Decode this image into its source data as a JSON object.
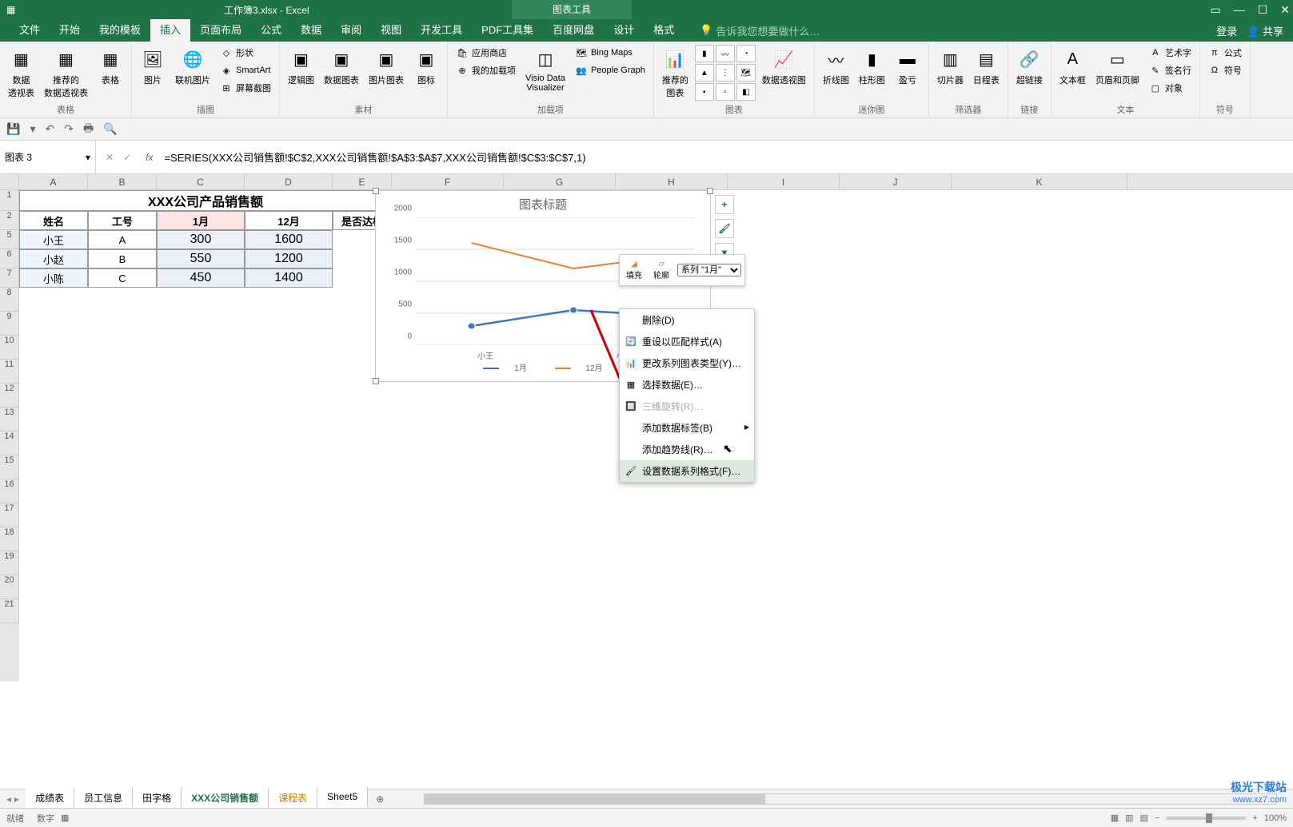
{
  "window": {
    "filename": "工作簿3.xlsx - Excel",
    "tool_tab": "图表工具"
  },
  "tabs": {
    "file": "文件",
    "home": "开始",
    "mytpl": "我的模板",
    "insert": "插入",
    "layout": "页面布局",
    "formula": "公式",
    "data": "数据",
    "review": "审阅",
    "view": "视图",
    "dev": "开发工具",
    "pdf": "PDF工具集",
    "baidu": "百度网盘",
    "design": "设计",
    "format": "格式",
    "tellme": "告诉我您想要做什么…",
    "login": "登录",
    "share": "共享"
  },
  "ribbon": {
    "tables": {
      "pivot": "数据\n透视表",
      "rec_pivot": "推荐的\n数据透视表",
      "table": "表格",
      "group": "表格"
    },
    "illust": {
      "pic": "图片",
      "online": "联机图片",
      "shapes": "形状",
      "smartart": "SmartArt",
      "screenshot": "屏幕截图",
      "group": "插图"
    },
    "addins": {
      "store": "应用商店",
      "myaddins": "我的加载项",
      "visio": "Visio Data\nVisualizer",
      "bing": "Bing Maps",
      "people": "People Graph",
      "group": "加载项"
    },
    "charts": {
      "rec": "推荐的\n图表",
      "pivot_chart": "数据透视图",
      "group": "图表"
    },
    "spark": {
      "line": "折线图",
      "col": "柱形图",
      "winloss": "盈亏",
      "group": "迷你图"
    },
    "filter": {
      "slicer": "切片器",
      "timeline": "日程表",
      "group": "筛选器"
    },
    "link": {
      "hyper": "超链接",
      "group": "链接"
    },
    "text": {
      "textbox": "文本框",
      "header": "页眉和页脚",
      "wordart": "艺术字",
      "sig": "签名行",
      "obj": "对象",
      "group": "文本"
    },
    "sym": {
      "eq": "公式",
      "sym": "符号",
      "group": "符号"
    },
    "素材": {
      "sm1": "逻辑图",
      "sm2": "数据图表",
      "sm3": "图片图表",
      "sm4": "图标",
      "group": "素材"
    }
  },
  "namebox": "图表 3",
  "formula": "=SERIES(XXX公司销售额!$C$2,XXX公司销售额!$A$3:$A$7,XXX公司销售额!$C$3:$C$7,1)",
  "columns": [
    "A",
    "B",
    "C",
    "D",
    "E",
    "F",
    "G",
    "H",
    "I",
    "J",
    "K"
  ],
  "table": {
    "title": "XXX公司产品销售额",
    "headers": {
      "name": "姓名",
      "id": "工号",
      "m1": "1月",
      "m12": "12月",
      "ok": "是否达标"
    },
    "rows": [
      {
        "name": "小王",
        "id": "A",
        "m1": "300",
        "m12": "1600"
      },
      {
        "name": "小赵",
        "id": "B",
        "m1": "550",
        "m12": "1200"
      },
      {
        "name": "小陈",
        "id": "C",
        "m1": "450",
        "m12": "1400"
      }
    ]
  },
  "chart": {
    "title": "图表标题",
    "legend1": "1月",
    "legend2": "12月",
    "y": [
      "0",
      "500",
      "1000",
      "1500",
      "2000"
    ],
    "x": [
      "小王",
      "小赵"
    ]
  },
  "chart_data": {
    "type": "line",
    "title": "图表标题",
    "categories": [
      "小王",
      "小赵",
      "小陈"
    ],
    "series": [
      {
        "name": "1月",
        "values": [
          300,
          550,
          450
        ],
        "color": "#4472c4"
      },
      {
        "name": "12月",
        "values": [
          1600,
          1200,
          1400
        ],
        "color": "#ed7d31"
      }
    ],
    "ylim": [
      0,
      2000
    ],
    "xlabel": "",
    "ylabel": ""
  },
  "mini_toolbar": {
    "fill": "填充",
    "outline": "轮廓",
    "series": "系列 \"1月\""
  },
  "context_menu": {
    "delete": "删除(D)",
    "reset": "重设以匹配样式(A)",
    "change_type": "更改系列图表类型(Y)…",
    "select_data": "选择数据(E)…",
    "rotate3d": "三维旋转(R)…",
    "add_label": "添加数据标签(B)",
    "add_trend": "添加趋势线(R)…",
    "format_series": "设置数据系列格式(F)…"
  },
  "sheets": {
    "s1": "成绩表",
    "s2": "员工信息",
    "s3": "田字格",
    "s4": "XXX公司销售额",
    "s5": "课程表",
    "s6": "Sheet5"
  },
  "status": {
    "ready": "就绪",
    "count": "数字",
    "zoom": "100%"
  },
  "watermark": {
    "t1": "极光下载站",
    "t2": "www.xz7.com"
  }
}
